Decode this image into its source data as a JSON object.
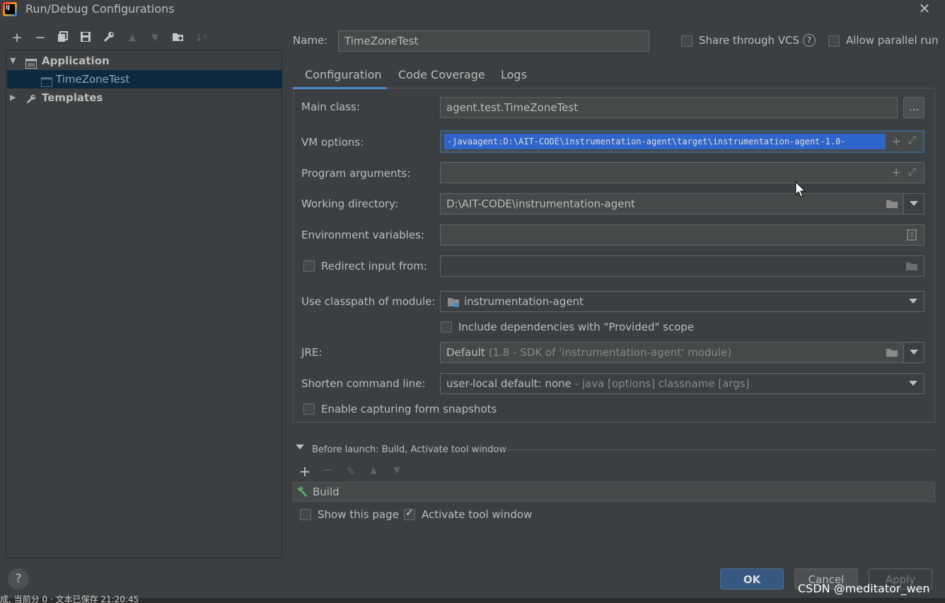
{
  "window": {
    "title": "Run/Debug Configurations",
    "close_icon": "close-icon",
    "app_icon_text": "IJ"
  },
  "left_toolbar": {
    "icons": [
      "add-icon",
      "remove-icon",
      "copy-icon",
      "save-icon",
      "wrench-icon",
      "move-up-icon",
      "move-down-icon",
      "new-folder-icon",
      "sort-icon"
    ]
  },
  "tree": {
    "items": [
      {
        "label": "Application",
        "icon": "application-icon",
        "expanded": true
      },
      {
        "label": "TimeZoneTest",
        "icon": "class-icon",
        "selected": true
      },
      {
        "label": "Templates",
        "icon": "wrench-icon",
        "expanded": false
      }
    ]
  },
  "header": {
    "name_label": "Name:",
    "name_value": "TimeZoneTest",
    "share_vcs_label": "Share through VCS",
    "allow_parallel_label": "Allow parallel run"
  },
  "tabs": [
    {
      "label": "Configuration",
      "active": true
    },
    {
      "label": "Code Coverage",
      "active": false
    },
    {
      "label": "Logs",
      "active": false
    }
  ],
  "form": {
    "main_class_label": "Main class:",
    "main_class_value": "agent.test.TimeZoneTest",
    "main_class_browse": "...",
    "vm_options_label": "VM options:",
    "vm_options_value": "-javaagent:D:\\AIT-CODE\\instrumentation-agent\\target\\instrumentation-agent-1.0-",
    "program_args_label": "Program arguments:",
    "program_args_value": "",
    "working_dir_label": "Working directory:",
    "working_dir_value": "D:\\AIT-CODE\\instrumentation-agent",
    "env_vars_label": "Environment variables:",
    "env_vars_value": "",
    "redirect_label": "Redirect input from:",
    "redirect_value": "",
    "classpath_label": "Use classpath of module:",
    "classpath_value": "instrumentation-agent",
    "include_deps_label": "Include dependencies with \"Provided\" scope",
    "jre_label": "JRE:",
    "jre_value": "Default",
    "jre_hint": "(1.8 - SDK of 'instrumentation-agent' module)",
    "shorten_label": "Shorten command line:",
    "shorten_value": "user-local default: none",
    "shorten_hint": "- java [options] classname [args]",
    "capture_label": "Enable capturing form snapshots"
  },
  "before_launch": {
    "title": "Before launch: Build, Activate tool window",
    "tasks": [
      {
        "label": "Build",
        "icon": "hammer-icon"
      }
    ],
    "show_page_label": "Show this page",
    "show_page_checked": false,
    "activate_label": "Activate tool window",
    "activate_checked": true
  },
  "buttons": {
    "ok": "OK",
    "cancel": "Cancel",
    "apply": "Apply",
    "help": "?"
  },
  "watermark": "CSDN @meditator_wen",
  "bottom_strip_text": "成, 当前分 0 · 文本已保存 21:20:45",
  "colors": {
    "background": "#3c3f41",
    "field": "#45494a",
    "selection": "#0d293e",
    "accent": "#4a88c7",
    "text_selection": "#2f65ca",
    "ok_button": "#365880"
  }
}
